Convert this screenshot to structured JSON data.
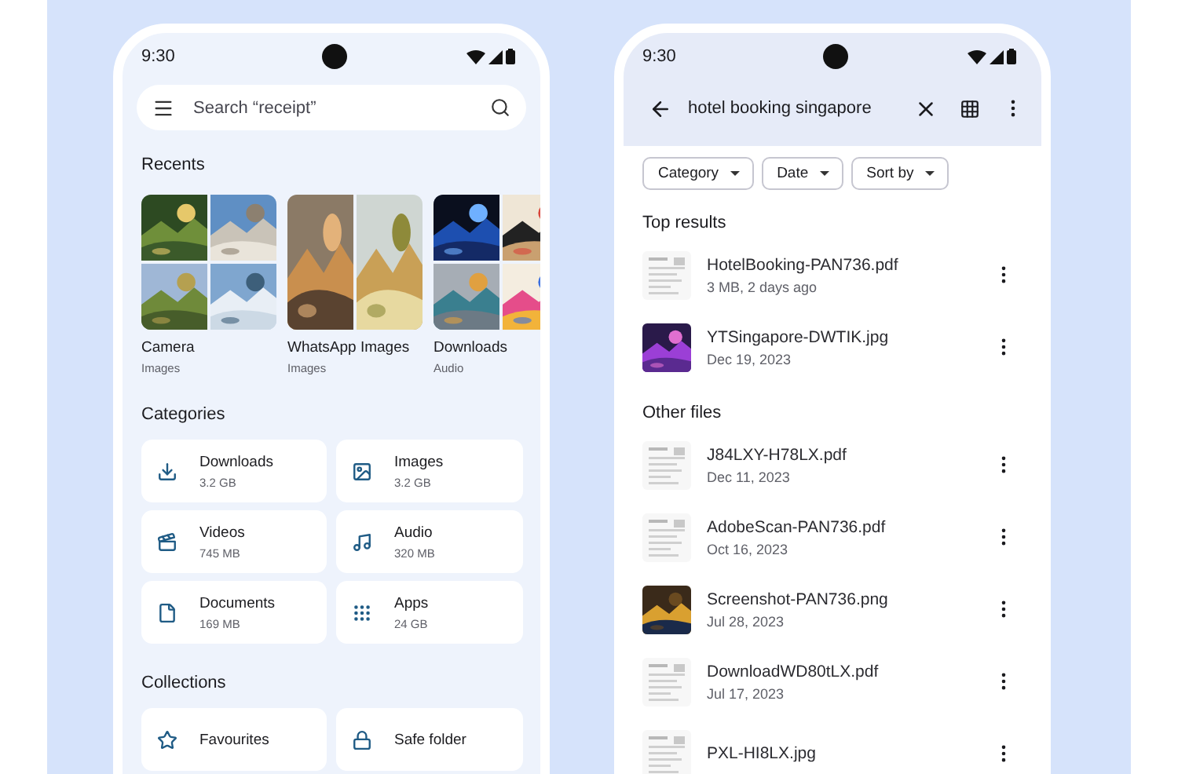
{
  "left_phone": {
    "status_time": "9:30",
    "search": {
      "placeholder": "Search “receipt”"
    },
    "recents": {
      "title": "Recents",
      "items": [
        {
          "name": "Camera",
          "type": "Images"
        },
        {
          "name": "WhatsApp Images",
          "type": "Images"
        },
        {
          "name": "Downloads",
          "type": "Audio"
        }
      ]
    },
    "categories": {
      "title": "Categories",
      "items": [
        {
          "kind": "downloads",
          "name": "Downloads",
          "size": "3.2 GB"
        },
        {
          "kind": "images",
          "name": "Images",
          "size": "3.2 GB"
        },
        {
          "kind": "videos",
          "name": "Videos",
          "size": "745 MB"
        },
        {
          "kind": "audio",
          "name": "Audio",
          "size": "320 MB"
        },
        {
          "kind": "documents",
          "name": "Documents",
          "size": "169 MB"
        },
        {
          "kind": "apps",
          "name": "Apps",
          "size": "24 GB"
        }
      ]
    },
    "collections": {
      "title": "Collections",
      "items": [
        {
          "kind": "favourites",
          "name": "Favourites"
        },
        {
          "kind": "safe",
          "name": "Safe folder"
        }
      ]
    }
  },
  "right_phone": {
    "status_time": "9:30",
    "search": {
      "value": "hotel booking singapore"
    },
    "filters": [
      {
        "label": "Category"
      },
      {
        "label": "Date"
      },
      {
        "label": "Sort by"
      }
    ],
    "sections": [
      {
        "title": "Top results",
        "files": [
          {
            "kind": "document",
            "name": "HotelBooking-PAN736.pdf",
            "detail": "3 MB, 2 days ago"
          },
          {
            "kind": "picture",
            "name": "YTSingapore-DWTIK.jpg",
            "detail": "Dec 19, 2023"
          }
        ]
      },
      {
        "title": "Other files",
        "files": [
          {
            "kind": "document",
            "name": "J84LXY-H78LX.pdf",
            "detail": "Dec 11, 2023"
          },
          {
            "kind": "document",
            "name": "AdobeScan-PAN736.pdf",
            "detail": "Oct 16, 2023"
          },
          {
            "kind": "picture",
            "name": "Screenshot-PAN736.png",
            "detail": "Jul 28, 2023"
          },
          {
            "kind": "document",
            "name": "DownloadWD80tLX.pdf",
            "detail": "Jul 17, 2023"
          },
          {
            "kind": "document",
            "name": "PXL-HI8LX.jpg"
          }
        ]
      }
    ]
  }
}
